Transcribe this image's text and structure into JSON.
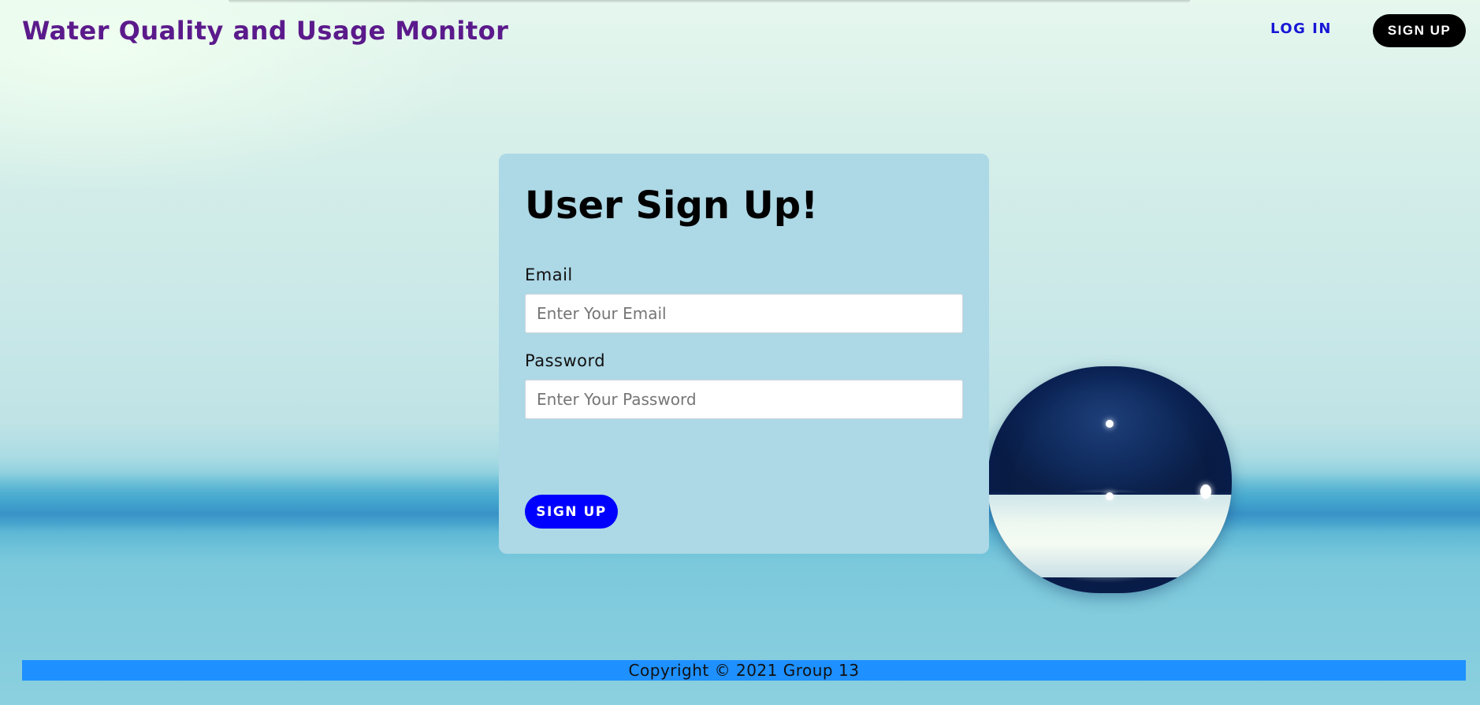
{
  "header": {
    "brand": "Water Quality and Usage Monitor",
    "login_label": "LOG IN",
    "signup_label": "SIGN UP"
  },
  "form": {
    "title": "User Sign Up!",
    "email": {
      "label": "Email",
      "placeholder": "Enter Your Email",
      "value": ""
    },
    "password": {
      "label": "Password",
      "placeholder": "Enter Your Password",
      "value": ""
    },
    "submit_label": "SIGN UP"
  },
  "footer": {
    "copyright": "Copyright © 2021 Group 13"
  },
  "colors": {
    "brand": "#5b1a8b",
    "login_link": "#1717d6",
    "nav_signup_bg": "#000000",
    "card_bg": "#add8e6",
    "submit_bg": "#0000ff",
    "footer_bg": "#1e90ff"
  },
  "icons": {
    "background": "water-droplet-image"
  }
}
